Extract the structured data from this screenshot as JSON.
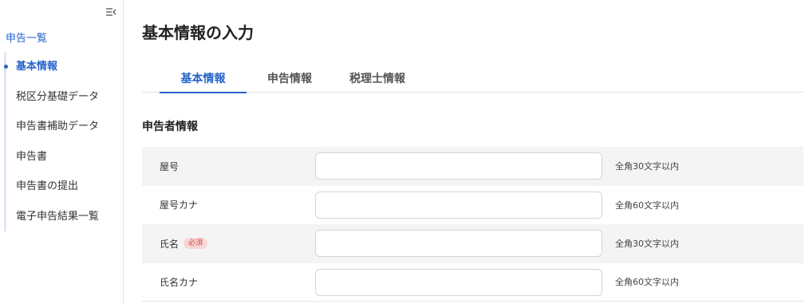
{
  "sidebar": {
    "collapse_icon": "collapse-sidebar-icon",
    "top_link": "申告一覧",
    "items": [
      {
        "label": "基本情報",
        "active": true
      },
      {
        "label": "税区分基礎データ",
        "active": false
      },
      {
        "label": "申告書補助データ",
        "active": false
      },
      {
        "label": "申告書",
        "active": false
      },
      {
        "label": "申告書の提出",
        "active": false
      },
      {
        "label": "電子申告結果一覧",
        "active": false
      }
    ]
  },
  "main": {
    "title": "基本情報の入力",
    "tabs": [
      {
        "label": "基本情報",
        "active": true
      },
      {
        "label": "申告情報",
        "active": false
      },
      {
        "label": "税理士情報",
        "active": false
      }
    ],
    "section_title": "申告者情報",
    "fields": [
      {
        "label": "屋号",
        "required": false,
        "value": "",
        "hint": "全角30文字以内"
      },
      {
        "label": "屋号カナ",
        "required": false,
        "value": "",
        "hint": "全角60文字以内"
      },
      {
        "label": "氏名",
        "required": true,
        "required_label": "必須",
        "value": "",
        "hint": "全角30文字以内"
      },
      {
        "label": "氏名カナ",
        "required": false,
        "value": "",
        "hint": "全角60文字以内"
      }
    ]
  },
  "colors": {
    "accent": "#2563c9",
    "row_alt_bg": "#f5f4f4",
    "required_badge_bg": "#f7d6d6",
    "required_badge_text": "#d04b4b"
  }
}
